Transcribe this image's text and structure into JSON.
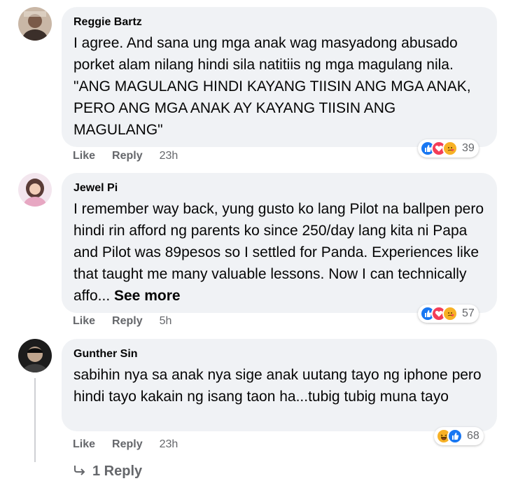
{
  "comments": [
    {
      "author": "Reggie Bartz",
      "text": "I agree. And sana ung mga anak wag masyadong abusado porket alam nilang hindi sila natitiis ng mga magulang nila. \"ANG MAGULANG HINDI KAYANG TIISIN ANG MGA ANAK, PERO ANG MGA ANAK AY KAYANG TIISIN ANG MAGULANG\"",
      "like_label": "Like",
      "reply_label": "Reply",
      "time": "23h",
      "reaction_icons": [
        "like-icon",
        "love-icon",
        "care-icon"
      ],
      "reaction_count": "39"
    },
    {
      "author": "Jewel Pi",
      "text": "I remember way back, yung gusto ko lang Pilot na ballpen pero hindi rin afford ng parents ko since 250/day lang kita ni Papa and Pilot was 89pesos so I settled for Panda. Experiences like that taught me many valuable lessons. Now I can technically affo...",
      "see_more": "See more",
      "like_label": "Like",
      "reply_label": "Reply",
      "time": "5h",
      "reaction_icons": [
        "like-icon",
        "love-icon",
        "care-icon"
      ],
      "reaction_count": "57"
    },
    {
      "author": "Gunther Sin",
      "text": "sabihin nya sa anak nya sige anak uutang tayo ng iphone pero hindi tayo kakain ng isang taon ha...tubig tubig muna tayo",
      "like_label": "Like",
      "reply_label": "Reply",
      "time": "23h",
      "reaction_icons": [
        "haha-icon",
        "like-icon"
      ],
      "reaction_count": "68",
      "replies_label": "1 Reply"
    }
  ],
  "colors": {
    "bubble": "#f0f2f5",
    "secondary_text": "#65676b",
    "like_blue": "#1877f2",
    "love_red": "#f33e58",
    "care_yellow": "#f7b125"
  }
}
